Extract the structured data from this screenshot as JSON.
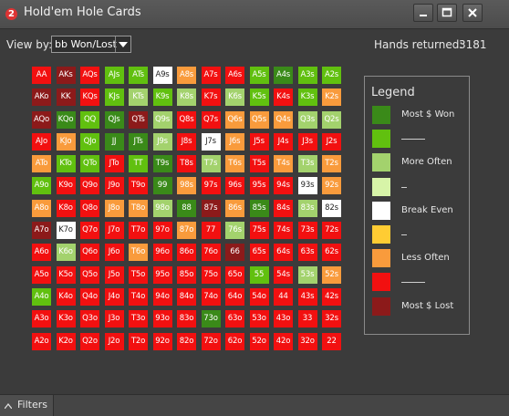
{
  "window": {
    "title": "Hold'em Hole Cards",
    "app_badge": "2"
  },
  "view_by": {
    "label": "View by:",
    "selected": "bb Won/Lost"
  },
  "hands": {
    "label": "Hands returned:",
    "value": "3181"
  },
  "colors": {
    "dg": "#3a8a19",
    "mg": "#61c00f",
    "lg": "#a3d26d",
    "pg": "#d7f4a8",
    "wh": "#ffffff",
    "yl": "#ffcc33",
    "or": "#f99b3c",
    "rd": "#f21010",
    "dr": "#8c1a1a"
  },
  "grid": [
    [
      [
        "AA",
        "rd"
      ],
      [
        "AKs",
        "dr"
      ],
      [
        "AQs",
        "rd"
      ],
      [
        "AJs",
        "mg"
      ],
      [
        "ATs",
        "mg"
      ],
      [
        "A9s",
        "wh"
      ],
      [
        "A8s",
        "or"
      ],
      [
        "A7s",
        "rd"
      ],
      [
        "A6s",
        "rd"
      ],
      [
        "A5s",
        "mg"
      ],
      [
        "A4s",
        "dg"
      ],
      [
        "A3s",
        "mg"
      ],
      [
        "A2s",
        "mg"
      ]
    ],
    [
      [
        "AKo",
        "dr"
      ],
      [
        "KK",
        "dr"
      ],
      [
        "KQs",
        "rd"
      ],
      [
        "KJs",
        "mg"
      ],
      [
        "KTs",
        "lg"
      ],
      [
        "K9s",
        "mg"
      ],
      [
        "K8s",
        "lg"
      ],
      [
        "K7s",
        "rd"
      ],
      [
        "K6s",
        "lg"
      ],
      [
        "K5s",
        "mg"
      ],
      [
        "K4s",
        "rd"
      ],
      [
        "K3s",
        "mg"
      ],
      [
        "K2s",
        "or"
      ]
    ],
    [
      [
        "AQo",
        "dr"
      ],
      [
        "KQo",
        "dg"
      ],
      [
        "QQ",
        "mg"
      ],
      [
        "QJs",
        "dg"
      ],
      [
        "QTs",
        "dr"
      ],
      [
        "Q9s",
        "lg"
      ],
      [
        "Q8s",
        "rd"
      ],
      [
        "Q7s",
        "rd"
      ],
      [
        "Q6s",
        "or"
      ],
      [
        "Q5s",
        "or"
      ],
      [
        "Q4s",
        "or"
      ],
      [
        "Q3s",
        "lg"
      ],
      [
        "Q2s",
        "lg"
      ]
    ],
    [
      [
        "AJo",
        "rd"
      ],
      [
        "KJo",
        "or"
      ],
      [
        "QJo",
        "mg"
      ],
      [
        "JJ",
        "dg"
      ],
      [
        "JTs",
        "dg"
      ],
      [
        "J9s",
        "lg"
      ],
      [
        "J8s",
        "rd"
      ],
      [
        "J7s",
        "wh"
      ],
      [
        "J6s",
        "or"
      ],
      [
        "J5s",
        "rd"
      ],
      [
        "J4s",
        "rd"
      ],
      [
        "J3s",
        "rd"
      ],
      [
        "J2s",
        "rd"
      ]
    ],
    [
      [
        "ATo",
        "or"
      ],
      [
        "KTo",
        "mg"
      ],
      [
        "QTo",
        "mg"
      ],
      [
        "JTo",
        "rd"
      ],
      [
        "TT",
        "mg"
      ],
      [
        "T9s",
        "dg"
      ],
      [
        "T8s",
        "rd"
      ],
      [
        "T7s",
        "lg"
      ],
      [
        "T6s",
        "or"
      ],
      [
        "T5s",
        "rd"
      ],
      [
        "T4s",
        "or"
      ],
      [
        "T3s",
        "lg"
      ],
      [
        "T2s",
        "or"
      ]
    ],
    [
      [
        "A9o",
        "mg"
      ],
      [
        "K9o",
        "rd"
      ],
      [
        "Q9o",
        "rd"
      ],
      [
        "J9o",
        "rd"
      ],
      [
        "T9o",
        "rd"
      ],
      [
        "99",
        "dg"
      ],
      [
        "98s",
        "or"
      ],
      [
        "97s",
        "rd"
      ],
      [
        "96s",
        "rd"
      ],
      [
        "95s",
        "rd"
      ],
      [
        "94s",
        "rd"
      ],
      [
        "93s",
        "wh"
      ],
      [
        "92s",
        "or"
      ]
    ],
    [
      [
        "A8o",
        "or"
      ],
      [
        "K8o",
        "rd"
      ],
      [
        "Q8o",
        "rd"
      ],
      [
        "J8o",
        "or"
      ],
      [
        "T8o",
        "or"
      ],
      [
        "98o",
        "lg"
      ],
      [
        "88",
        "dg"
      ],
      [
        "87s",
        "dr"
      ],
      [
        "86s",
        "or"
      ],
      [
        "85s",
        "dg"
      ],
      [
        "84s",
        "rd"
      ],
      [
        "83s",
        "lg"
      ],
      [
        "82s",
        "wh"
      ]
    ],
    [
      [
        "A7o",
        "dr"
      ],
      [
        "K7o",
        "wh"
      ],
      [
        "Q7o",
        "rd"
      ],
      [
        "J7o",
        "rd"
      ],
      [
        "T7o",
        "rd"
      ],
      [
        "97o",
        "rd"
      ],
      [
        "87o",
        "or"
      ],
      [
        "77",
        "rd"
      ],
      [
        "76s",
        "lg"
      ],
      [
        "75s",
        "rd"
      ],
      [
        "74s",
        "rd"
      ],
      [
        "73s",
        "rd"
      ],
      [
        "72s",
        "rd"
      ]
    ],
    [
      [
        "A6o",
        "rd"
      ],
      [
        "K6o",
        "lg"
      ],
      [
        "Q6o",
        "rd"
      ],
      [
        "J6o",
        "rd"
      ],
      [
        "T6o",
        "or"
      ],
      [
        "96o",
        "rd"
      ],
      [
        "86o",
        "rd"
      ],
      [
        "76o",
        "rd"
      ],
      [
        "66",
        "dr"
      ],
      [
        "65s",
        "rd"
      ],
      [
        "64s",
        "rd"
      ],
      [
        "63s",
        "rd"
      ],
      [
        "62s",
        "rd"
      ]
    ],
    [
      [
        "A5o",
        "rd"
      ],
      [
        "K5o",
        "rd"
      ],
      [
        "Q5o",
        "rd"
      ],
      [
        "J5o",
        "rd"
      ],
      [
        "T5o",
        "rd"
      ],
      [
        "95o",
        "rd"
      ],
      [
        "85o",
        "rd"
      ],
      [
        "75o",
        "rd"
      ],
      [
        "65o",
        "rd"
      ],
      [
        "55",
        "mg"
      ],
      [
        "54s",
        "rd"
      ],
      [
        "53s",
        "lg"
      ],
      [
        "52s",
        "or"
      ]
    ],
    [
      [
        "A4o",
        "mg"
      ],
      [
        "K4o",
        "rd"
      ],
      [
        "Q4o",
        "rd"
      ],
      [
        "J4o",
        "rd"
      ],
      [
        "T4o",
        "rd"
      ],
      [
        "94o",
        "rd"
      ],
      [
        "84o",
        "rd"
      ],
      [
        "74o",
        "rd"
      ],
      [
        "64o",
        "rd"
      ],
      [
        "54o",
        "rd"
      ],
      [
        "44",
        "rd"
      ],
      [
        "43s",
        "rd"
      ],
      [
        "42s",
        "rd"
      ]
    ],
    [
      [
        "A3o",
        "rd"
      ],
      [
        "K3o",
        "rd"
      ],
      [
        "Q3o",
        "rd"
      ],
      [
        "J3o",
        "rd"
      ],
      [
        "T3o",
        "rd"
      ],
      [
        "93o",
        "rd"
      ],
      [
        "83o",
        "rd"
      ],
      [
        "73o",
        "dg"
      ],
      [
        "63o",
        "rd"
      ],
      [
        "53o",
        "rd"
      ],
      [
        "43o",
        "rd"
      ],
      [
        "33",
        "rd"
      ],
      [
        "32s",
        "rd"
      ]
    ],
    [
      [
        "A2o",
        "rd"
      ],
      [
        "K2o",
        "rd"
      ],
      [
        "Q2o",
        "rd"
      ],
      [
        "J2o",
        "rd"
      ],
      [
        "T2o",
        "rd"
      ],
      [
        "92o",
        "rd"
      ],
      [
        "82o",
        "rd"
      ],
      [
        "72o",
        "rd"
      ],
      [
        "62o",
        "rd"
      ],
      [
        "52o",
        "rd"
      ],
      [
        "42o",
        "rd"
      ],
      [
        "32o",
        "rd"
      ],
      [
        "22",
        "rd"
      ]
    ]
  ],
  "legend": {
    "title": "Legend",
    "items": [
      {
        "label": "Most $ Won",
        "color": "dg"
      },
      {
        "label": "",
        "color": "mg",
        "dash": "long"
      },
      {
        "label": "More Often",
        "color": "lg"
      },
      {
        "label": "",
        "color": "pg",
        "dash": "short"
      },
      {
        "label": "Break Even",
        "color": "wh"
      },
      {
        "label": "",
        "color": "yl",
        "dash": "short"
      },
      {
        "label": "Less Often",
        "color": "or"
      },
      {
        "label": "",
        "color": "rd",
        "dash": "long"
      },
      {
        "label": "Most $ Lost",
        "color": "dr"
      }
    ]
  },
  "footer": {
    "filters_label": "Filters"
  }
}
